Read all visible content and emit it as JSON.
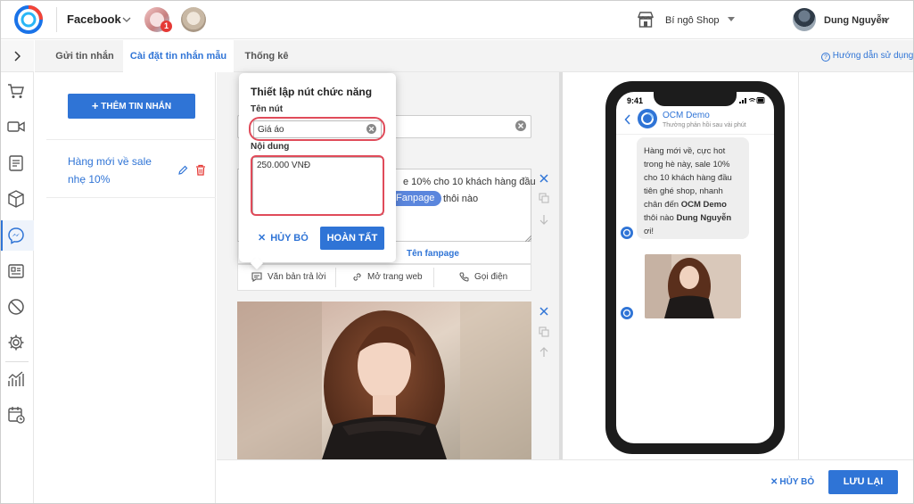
{
  "header": {
    "channel": "Facebook",
    "page_badge": "1",
    "shop_name": "Bí ngô Shop",
    "user_name": "Dung Nguyễn"
  },
  "sidebar": {
    "icons": [
      "cart-icon",
      "video-icon",
      "document-icon",
      "box-icon",
      "messenger-icon",
      "form-icon",
      "block-icon",
      "settings-icon",
      "chart-icon",
      "calendar-report-icon"
    ],
    "active": "messenger-icon"
  },
  "tabs": [
    {
      "label": "Gửi tin nhắn"
    },
    {
      "label": "Cài đặt tin nhắn mẫu",
      "active": true
    },
    {
      "label": "Thống kê"
    }
  ],
  "guide_link": "Hướng dẫn sử dụng",
  "left_panel": {
    "add_button": "THÊM TIN NHẮN",
    "items": [
      {
        "label": "Hàng mới về sale nhẹ 10%"
      }
    ]
  },
  "editor": {
    "text_line1": "e 10% cho 10 khách hàng đầu",
    "fanpage_chip": "Fanpage",
    "text_line2": "thôi nào",
    "variable": "Tên fanpage",
    "button_options": [
      "Văn bản trả lời",
      "Mở trang web",
      "Gọi điện"
    ]
  },
  "popup": {
    "title": "Thiết lập nút chức năng",
    "name_label": "Tên nút",
    "name_value": "Giá áo",
    "content_label": "Nội dung",
    "content_value": "250.000 VNĐ",
    "cancel": "HỦY BỎ",
    "done": "HOÀN TẤT"
  },
  "preview": {
    "time": "9:41",
    "page_name": "OCM Demo",
    "subtitle": "Thường phản hồi sau vài phút",
    "msg_part1": "Hàng mới về, cực hot trong hè này, sale 10% cho 10 khách hàng đầu tiên ghé shop, nhanh chân đến ",
    "msg_bold1": "OCM Demo",
    "msg_part2": " thôi nào ",
    "msg_bold2": "Dung Nguyễn",
    "msg_part3": " ơi!"
  },
  "footer": {
    "cancel": "HỦY BỎ",
    "save": "LƯU LẠI"
  },
  "colors": {
    "accent": "#2f74d6",
    "highlight": "#e04b5a",
    "delete": "#e53935"
  }
}
